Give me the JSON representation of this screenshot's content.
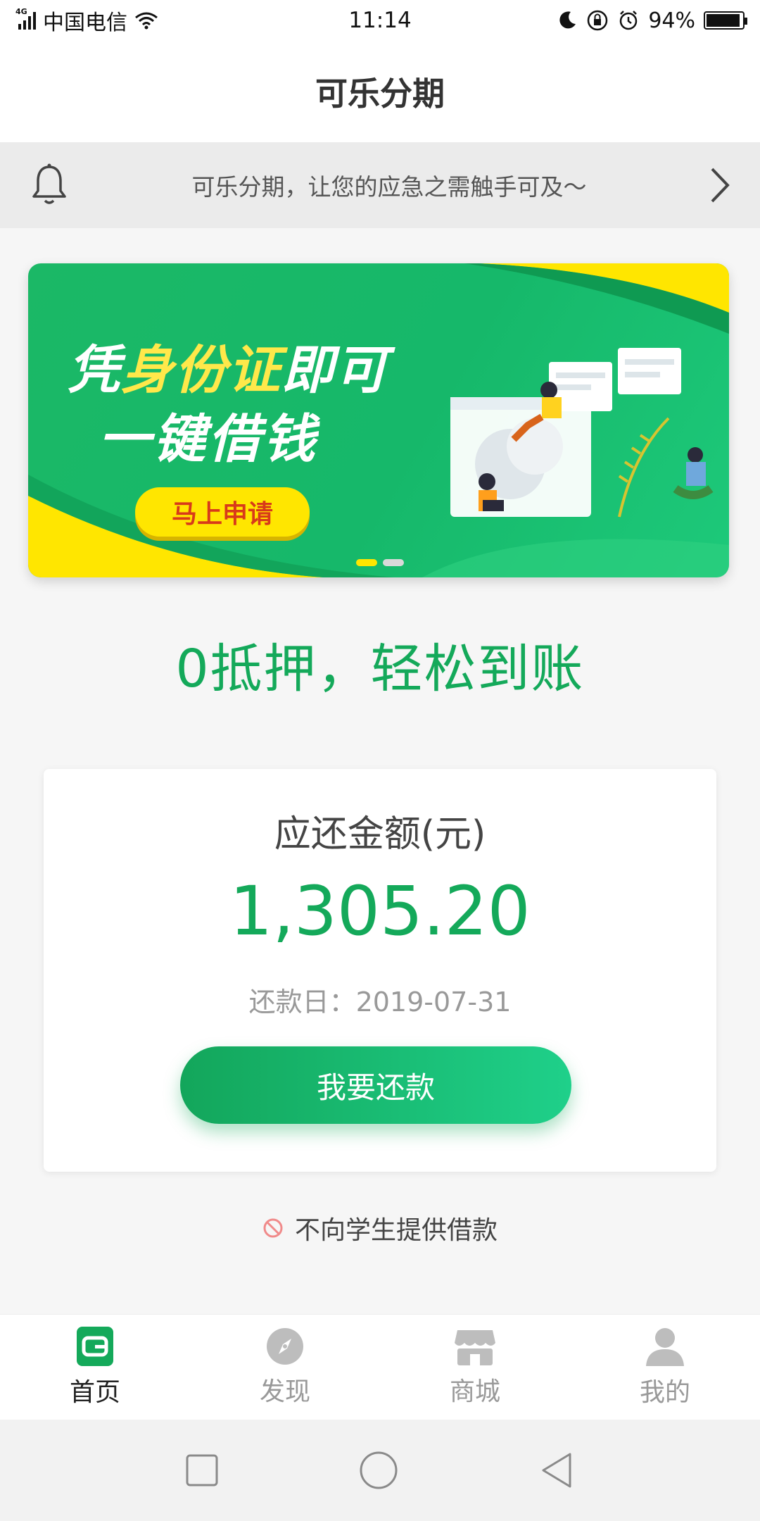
{
  "status_bar": {
    "network": "4G",
    "carrier": "中国电信",
    "time": "11:14",
    "battery_percent": "94%",
    "battery_level": 0.94
  },
  "header": {
    "title": "可乐分期"
  },
  "notice": {
    "text": "可乐分期，让您的应急之需触手可及～"
  },
  "banner": {
    "line1_part1": "凭",
    "line1_highlight": "身份证",
    "line1_part2": "即可",
    "line2": "一键借钱",
    "button": "马上申请",
    "slide_count": 2,
    "active_slide": 0
  },
  "slogan": "0抵押，轻松到账",
  "repayment": {
    "label": "应还金额(元)",
    "amount": "1,305.20",
    "due_date": "还款日：2019-07-31",
    "button": "我要还款"
  },
  "footer_note": "不向学生提供借款",
  "tabs": [
    {
      "label": "首页",
      "icon": "wallet-icon",
      "active": true
    },
    {
      "label": "发现",
      "icon": "compass-icon",
      "active": false
    },
    {
      "label": "商城",
      "icon": "store-icon",
      "active": false
    },
    {
      "label": "我的",
      "icon": "user-icon",
      "active": false
    }
  ],
  "colors": {
    "primary": "#14a95a",
    "accent_yellow": "#ffe600",
    "tab_inactive": "#bdbdbd"
  }
}
